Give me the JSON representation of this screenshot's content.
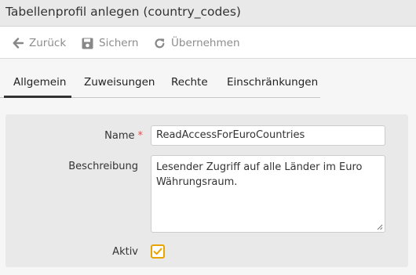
{
  "window": {
    "title": "Tabellenprofil anlegen (country_codes)"
  },
  "toolbar": {
    "back": {
      "label": "Zurück",
      "icon": "arrow-left-icon"
    },
    "save": {
      "label": "Sichern",
      "icon": "floppy-disk-icon"
    },
    "apply": {
      "label": "Übernehmen",
      "icon": "refresh-icon"
    }
  },
  "tabs": [
    {
      "label": "Allgemein",
      "active": true
    },
    {
      "label": "Zuweisungen",
      "active": false
    },
    {
      "label": "Rechte",
      "active": false
    },
    {
      "label": "Einschränkungen",
      "active": false
    }
  ],
  "form": {
    "name": {
      "label": "Name",
      "required_marker": "*",
      "value": "ReadAccessForEuroCountries"
    },
    "description": {
      "label": "Beschreibung",
      "value": "Lesender Zugriff auf alle Länder im Euro Währungsraum."
    },
    "active": {
      "label": "Aktiv",
      "checked": true
    }
  },
  "colors": {
    "accent": "#e8a400",
    "required": "#d9534f",
    "toolbar_text": "#8c8c8c"
  }
}
